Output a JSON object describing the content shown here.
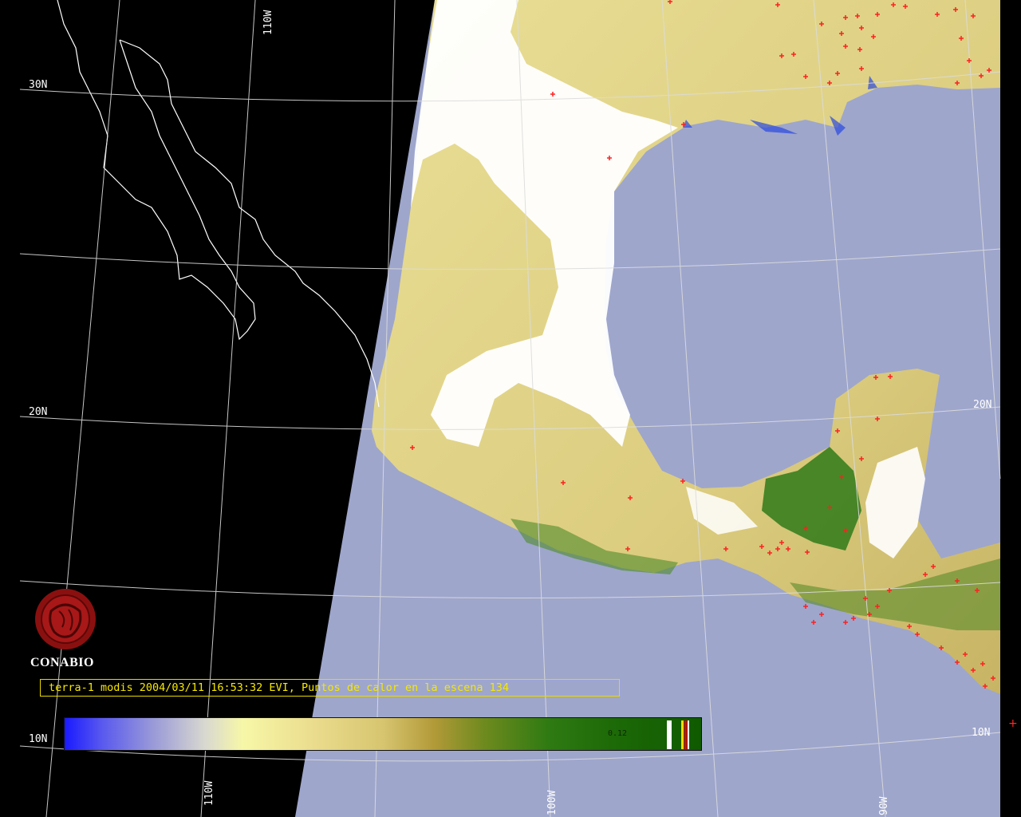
{
  "map": {
    "grid_labels": {
      "lat_30": "30N",
      "lat_20_left": "20N",
      "lat_20_right": "20N",
      "lat_10_left": "10N",
      "lat_10_right": "10N",
      "lon_110_top": "110W",
      "lon_110_bottom": "110W",
      "lon_100_bottom": "100W",
      "lon_90_bottom": "90W"
    },
    "colors": {
      "background": "#000000",
      "ocean": "#9ea6cc",
      "land_dry": "#e8dd8e",
      "land_green": "#2f7a1a",
      "cloud": "#ffffff",
      "hotspot": "#ff2020",
      "coast_water": "#2840d8"
    }
  },
  "branding": {
    "logo_text": "CONABIO"
  },
  "caption": {
    "text": "terra-1 modis 2004/03/11 16:53:32 EVI, Puntos de calor en la escena 134"
  },
  "colorbar": {
    "tick_label": "0.12"
  },
  "edge_marker": "+"
}
